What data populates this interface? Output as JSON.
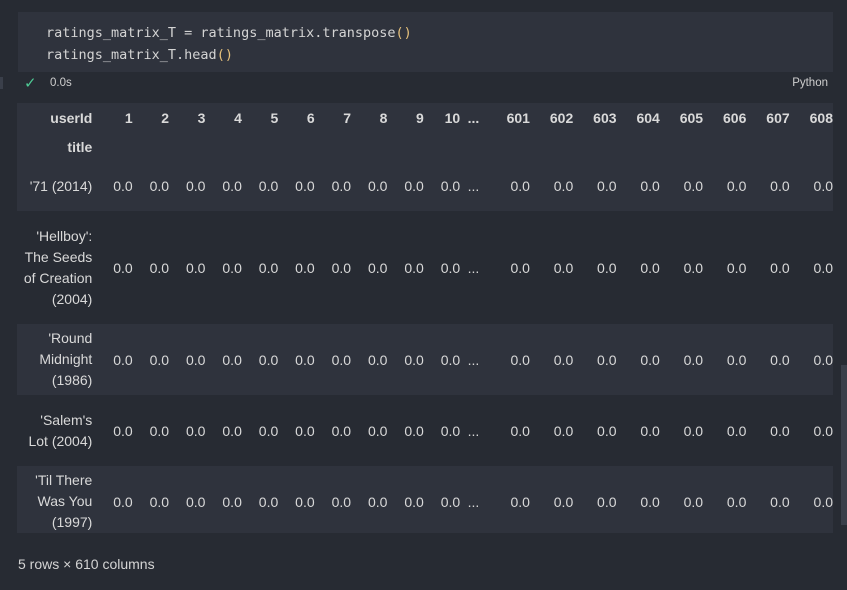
{
  "code": {
    "line1_prefix": "ratings_matrix_T = ratings_matrix.transpose",
    "line1_parens": "()",
    "line2_prefix": "ratings_matrix_T.head",
    "line2_parens": "()"
  },
  "cell_status": {
    "check_icon": "✓",
    "exec_time": "0.0s",
    "language": "Python"
  },
  "table": {
    "index_header": "userId",
    "index_name": "title",
    "columns": [
      "1",
      "2",
      "3",
      "4",
      "5",
      "6",
      "7",
      "8",
      "9",
      "10",
      "...",
      "601",
      "602",
      "603",
      "604",
      "605",
      "606",
      "607",
      "608"
    ],
    "rows": [
      {
        "title": "'71 (2014)",
        "values": [
          "0.0",
          "0.0",
          "0.0",
          "0.0",
          "0.0",
          "0.0",
          "0.0",
          "0.0",
          "0.0",
          "0.0",
          "...",
          "0.0",
          "0.0",
          "0.0",
          "0.0",
          "0.0",
          "0.0",
          "0.0",
          "0.0"
        ]
      },
      {
        "title": "'Hellboy': The Seeds of Creation (2004)",
        "values": [
          "0.0",
          "0.0",
          "0.0",
          "0.0",
          "0.0",
          "0.0",
          "0.0",
          "0.0",
          "0.0",
          "0.0",
          "...",
          "0.0",
          "0.0",
          "0.0",
          "0.0",
          "0.0",
          "0.0",
          "0.0",
          "0.0"
        ]
      },
      {
        "title": "'Round Midnight (1986)",
        "values": [
          "0.0",
          "0.0",
          "0.0",
          "0.0",
          "0.0",
          "0.0",
          "0.0",
          "0.0",
          "0.0",
          "0.0",
          "...",
          "0.0",
          "0.0",
          "0.0",
          "0.0",
          "0.0",
          "0.0",
          "0.0",
          "0.0"
        ]
      },
      {
        "title": "'Salem's Lot (2004)",
        "values": [
          "0.0",
          "0.0",
          "0.0",
          "0.0",
          "0.0",
          "0.0",
          "0.0",
          "0.0",
          "0.0",
          "0.0",
          "...",
          "0.0",
          "0.0",
          "0.0",
          "0.0",
          "0.0",
          "0.0",
          "0.0",
          "0.0"
        ]
      },
      {
        "title": "'Til There Was You (1997)",
        "values": [
          "0.0",
          "0.0",
          "0.0",
          "0.0",
          "0.0",
          "0.0",
          "0.0",
          "0.0",
          "0.0",
          "0.0",
          "...",
          "0.0",
          "0.0",
          "0.0",
          "0.0",
          "0.0",
          "0.0",
          "0.0",
          "0.0"
        ]
      }
    ]
  },
  "footer": {
    "shape": "5 rows × 610 columns"
  },
  "colors": {
    "background": "#272b33",
    "cell_background": "#2f333d",
    "check": "#4ec994",
    "paren": "#e5c07b"
  }
}
